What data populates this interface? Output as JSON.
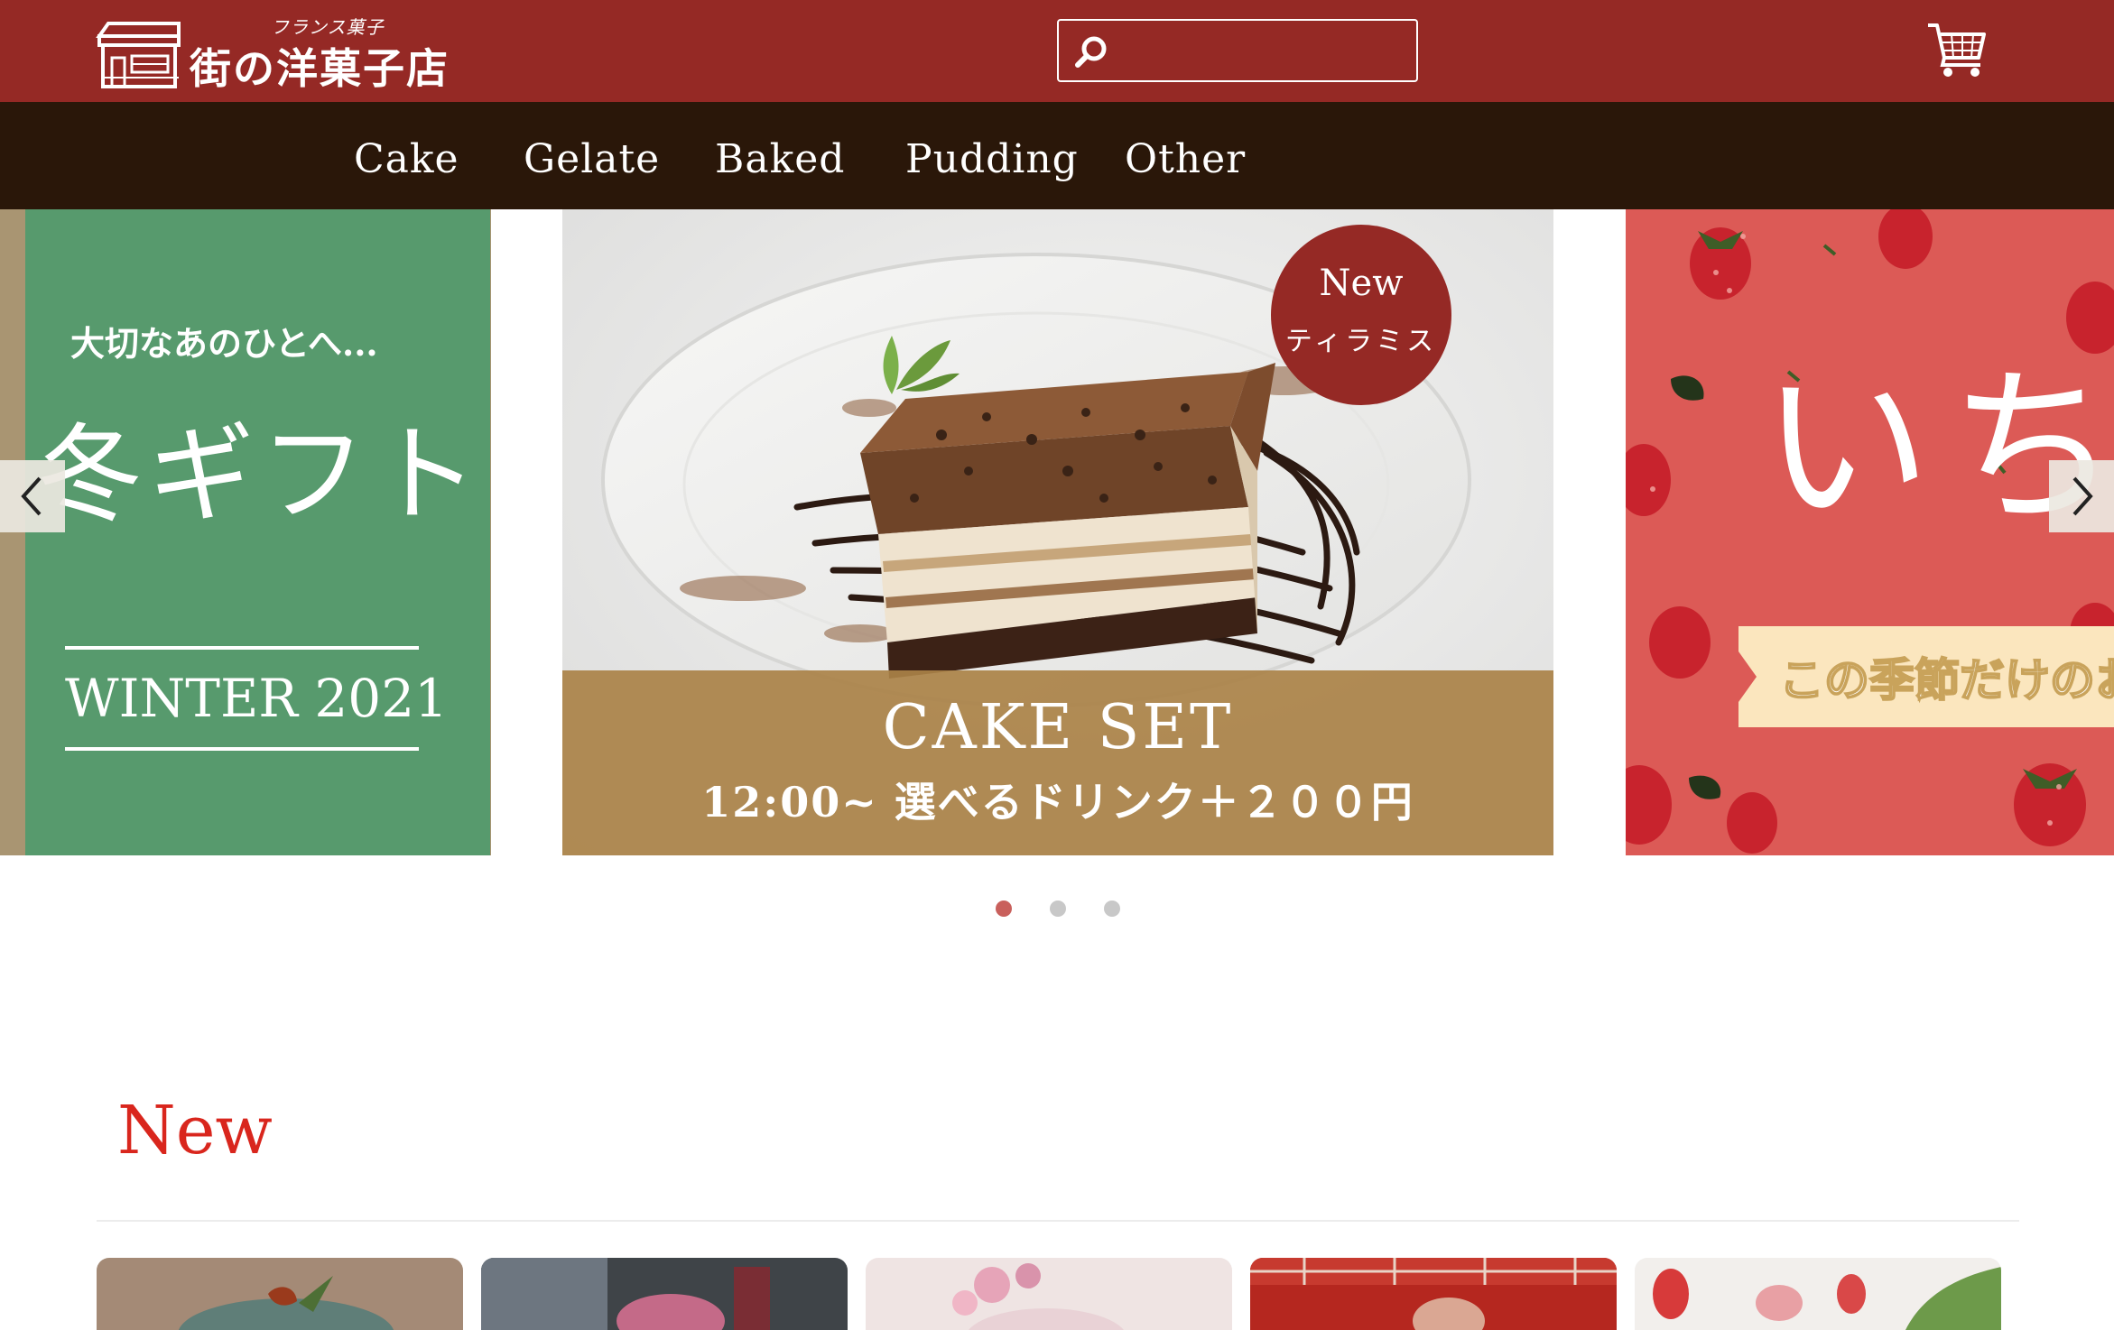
{
  "header": {
    "logo_small": "フランス菓子",
    "logo_big": "街の洋菓子店",
    "search_value": "",
    "search_placeholder": "",
    "colors": {
      "bar": "#952925",
      "nav": "#2a1709"
    },
    "icons": [
      "shop-icon",
      "search-icon",
      "cart-icon"
    ]
  },
  "nav": {
    "items": [
      "Cake",
      "Gelate",
      "Baked",
      "Pudding",
      "Other"
    ]
  },
  "slider": {
    "left_slide": {
      "subtitle": "大切なあのひとへ...",
      "title": "冬ギフト",
      "tag": "WINTER 2021"
    },
    "center_slide": {
      "badge_new": "New",
      "badge_name": "ティラミス",
      "title": "CAKE SET",
      "subtitle": "12:00~ 選べるドリンク＋２００円"
    },
    "right_slide": {
      "big_text": "いち",
      "ribbon_text": "この季節だけのお"
    },
    "dots": {
      "count": 3,
      "active": 1
    }
  },
  "new_section": {
    "title": "New",
    "cards": 5
  }
}
